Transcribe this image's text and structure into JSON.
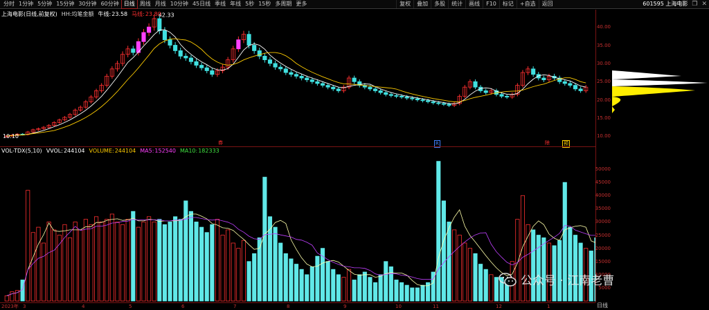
{
  "toolbar": {
    "periods": [
      "分时",
      "1分钟",
      "5分钟",
      "15分钟",
      "30分钟",
      "60分钟",
      "日线",
      "周线",
      "月线",
      "10分钟",
      "45日线",
      "季线",
      "年线",
      "5秒",
      "15秒",
      "多周期",
      "更多"
    ],
    "active_period": "日线",
    "tools": [
      "复权",
      "叠加",
      "多股",
      "统计",
      "画线",
      "F10",
      "标记",
      "+自选",
      "返回"
    ],
    "stock_code_name": "601595 上海电影",
    "window_icons": [
      "restore-icon",
      "close-icon"
    ]
  },
  "main_legend": {
    "title": "上海电影(日线,前复权)",
    "indicator": "HH:均笔金额",
    "ma_label": "牛线:",
    "ma_value": "23.58",
    "ma2_label": "马线:",
    "ma2_value": "23.80",
    "colors": {
      "up": "#ff3030",
      "down": "#40e0e0",
      "ma1": "#ffffff",
      "ma2": "#ffcc00",
      "magenta": "#ff40ff"
    }
  },
  "main_annotations": {
    "high_label": "42.33",
    "low_label": "10.10"
  },
  "price_axis": {
    "ticks": [
      "40.00",
      "35.00",
      "30.00",
      "25.00",
      "20.00",
      "15.00",
      "10.00"
    ]
  },
  "event_tags": [
    {
      "text": "券",
      "color": "#ff3030"
    },
    {
      "text": "R",
      "color": "#4080ff"
    },
    {
      "text": "除",
      "color": "#ff3030"
    },
    {
      "text": "预",
      "color": "#ffcc00"
    }
  ],
  "vol_legend": {
    "title": "VOL-TDX(5,10)",
    "vvol_label": "VVOL:",
    "vvol": "244104",
    "volume_label": "VOLUME:",
    "volume": "244104",
    "ma5_label": "MA5:",
    "ma5": "152540",
    "ma10_label": "MA10:",
    "ma10": "182333"
  },
  "vol_axis": {
    "ticks": [
      "50000",
      "45000",
      "40000",
      "35000",
      "30000",
      "25000",
      "20000",
      "15000",
      "10000",
      "5000"
    ],
    "unit": "X10"
  },
  "date_axis": {
    "ticks": [
      "2023年",
      "3",
      "4",
      "5",
      "6",
      "7",
      "8",
      "9",
      "10",
      "11",
      "12",
      "1"
    ]
  },
  "timeframe_label": "日线",
  "watermark": {
    "text": "公众号 · 江南老曹"
  },
  "chart_data": {
    "type": "candlestick",
    "title": "上海电影(日线,前复权)",
    "price_ylim": [
      8,
      44
    ],
    "volume_ylim": [
      0,
      55000
    ],
    "closes": [
      10.1,
      10.3,
      10.6,
      10.5,
      11.2,
      11.8,
      12.1,
      12.5,
      13.0,
      13.8,
      14.5,
      15.2,
      16.0,
      17.2,
      18.0,
      19.5,
      20.8,
      22.5,
      24.0,
      26.5,
      28.5,
      30.0,
      32.5,
      34.0,
      33.0,
      36.0,
      38.5,
      40.0,
      42.3,
      39.0,
      36.5,
      35.0,
      33.5,
      32.0,
      31.5,
      30.5,
      29.5,
      28.8,
      28.0,
      27.0,
      28.0,
      29.0,
      31.0,
      34.0,
      36.5,
      38.0,
      35.0,
      33.5,
      32.0,
      31.0,
      30.0,
      29.0,
      28.5,
      27.5,
      27.0,
      26.5,
      26.0,
      25.5,
      25.0,
      24.5,
      24.0,
      23.5,
      23.0,
      22.5,
      23.5,
      26.0,
      25.0,
      24.0,
      23.5,
      23.0,
      22.5,
      22.0,
      21.5,
      21.2,
      21.0,
      20.8,
      20.5,
      20.3,
      20.0,
      19.8,
      19.5,
      19.2,
      19.0,
      18.8,
      18.5,
      19.0,
      21.0,
      23.5,
      25.0,
      23.5,
      22.5,
      22.0,
      22.5,
      21.5,
      21.0,
      20.8,
      21.5,
      24.0,
      27.5,
      28.5,
      27.0,
      26.0,
      25.5,
      26.5,
      26.0,
      25.0,
      24.5,
      24.0,
      23.0,
      22.5,
      23.5
    ],
    "volumes": [
      2000,
      3500,
      4000,
      8000,
      42000,
      26000,
      28000,
      22000,
      30000,
      27000,
      25000,
      29000,
      24000,
      30000,
      27000,
      31000,
      29000,
      32000,
      30000,
      31000,
      33000,
      30000,
      29000,
      31000,
      34000,
      28000,
      30000,
      32000,
      30000,
      31000,
      29000,
      30000,
      32000,
      31000,
      38000,
      34000,
      30000,
      28000,
      26000,
      29000,
      31000,
      25000,
      27000,
      22000,
      20000,
      23000,
      15000,
      18000,
      24000,
      47000,
      32000,
      28000,
      22000,
      18000,
      16000,
      14000,
      12000,
      10000,
      13000,
      17000,
      20000,
      15000,
      12000,
      10000,
      9000,
      12000,
      8000,
      10000,
      11000,
      9000,
      7000,
      10000,
      15000,
      13000,
      8000,
      7000,
      6000,
      5000,
      5000,
      6000,
      7000,
      11000,
      53000,
      38000,
      30000,
      27000,
      25000,
      22000,
      20000,
      18000,
      14000,
      12000,
      10000,
      9000,
      9000,
      8000,
      15000,
      31000,
      40000,
      29000,
      27000,
      25000,
      24000,
      22000,
      21000,
      23000,
      45000,
      28000,
      25000,
      22000,
      20000,
      19000,
      24000
    ],
    "series": [
      {
        "name": "牛线",
        "color": "#ffffff"
      },
      {
        "name": "马线",
        "color": "#ffcc00"
      }
    ]
  }
}
